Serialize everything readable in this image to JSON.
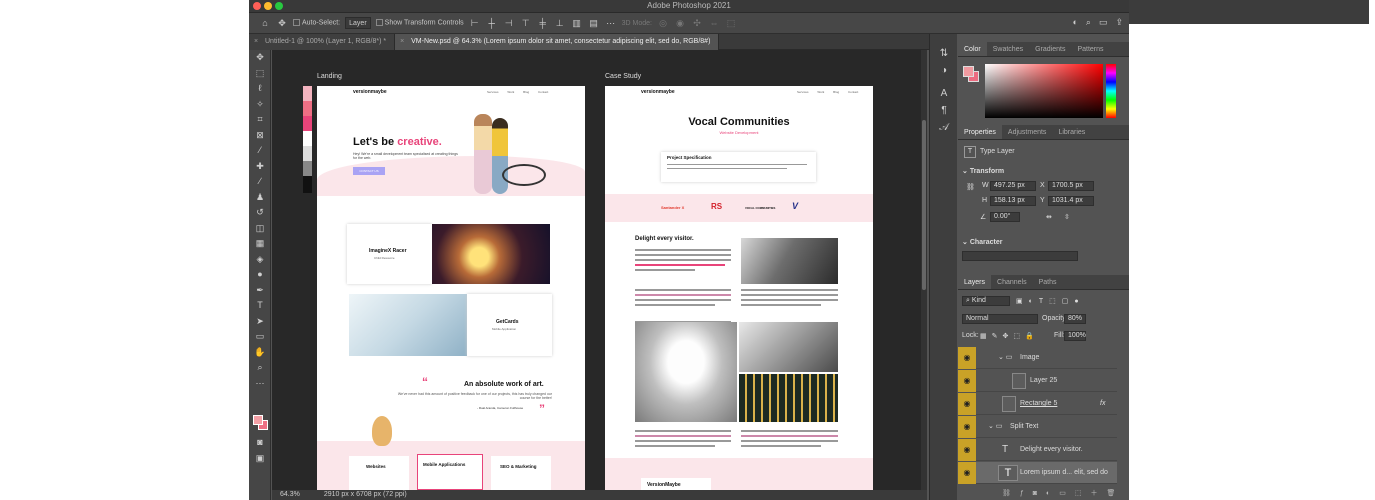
{
  "window": {
    "title": "Adobe Photoshop 2021"
  },
  "options_bar": {
    "auto_select_label": "Auto-Select:",
    "auto_select_value": "Layer",
    "show_transform_label": "Show Transform Controls",
    "mode_3d_label": "3D Mode:"
  },
  "tabs": [
    {
      "label": "Untitled-1 @ 100% (Layer 1, RGB/8*) *"
    },
    {
      "label": "VM-New.psd @ 64.3% (Lorem ipsum dolor sit amet, consectetur adipiscing elit, sed do, RGB/8#)"
    }
  ],
  "canvas": {
    "artboards": [
      {
        "label": "Landing"
      },
      {
        "label": "Case Study"
      }
    ]
  },
  "landing": {
    "logo": "versionmaybe",
    "nav": [
      "Services",
      "Work",
      "Blog",
      "Contact"
    ],
    "hero_title_a": "Let's be ",
    "hero_title_b": "creative.",
    "hero_sub": "Hey! We're a small development team specialised at creating things for the web.",
    "cta": "CONTACT US",
    "card1_title": "ImagineX Racer",
    "card1_sub": "Child Resource",
    "card2_title": "GetCards",
    "card2_sub": "Mobile Application",
    "quote_title": "An absolute work of art.",
    "quote_body": "We've never had this amount of positive feedback for one of our projects, this has truly changed our course for the better!",
    "quote_author": "- Rual Aranda, Cameron Fullhouse",
    "services": [
      "Websites",
      "Mobile Applications",
      "SEO & Marketing"
    ]
  },
  "case_study": {
    "logo": "versionmaybe",
    "title": "Vocal Communities",
    "subtitle": "Website Development",
    "spec_title": "Project Specification",
    "brands": [
      "Santander X",
      "RS",
      "VOCAL COMMUNITIES",
      "V"
    ],
    "section_title": "Delight every visitor.",
    "footer_logo": "VersionMaybe"
  },
  "status": {
    "zoom": "64.3%",
    "doc_size": "2910 px x 6708 px (72 ppi)"
  },
  "color_panel": {
    "tabs": [
      "Color",
      "Swatches",
      "Gradients",
      "Patterns"
    ]
  },
  "properties": {
    "tabs": [
      "Properties",
      "Adjustments",
      "Libraries"
    ],
    "type_label": "Type Layer",
    "transform_label": "Transform",
    "w": "497.25 px",
    "x": "1700.5 px",
    "h": "158.13 px",
    "y": "1031.4 px",
    "angle": "0.00°",
    "character_label": "Character"
  },
  "layers": {
    "tabs": [
      "Layers",
      "Channels",
      "Paths"
    ],
    "filter": "Kind",
    "blend": "Normal",
    "opacity_label": "Opacity:",
    "opacity": "80%",
    "lock_label": "Lock:",
    "fill_label": "Fill:",
    "fill": "100%",
    "items": [
      {
        "name": "Image",
        "kind": "folder"
      },
      {
        "name": "Layer 25",
        "kind": "pixel"
      },
      {
        "name": "Rectangle 5",
        "kind": "shape"
      },
      {
        "name": "Split Text",
        "kind": "folder"
      },
      {
        "name": "Delight every visitor.",
        "kind": "text"
      },
      {
        "name": "Lorem ipsum d... elit, sed do",
        "kind": "text"
      }
    ],
    "fx_label": "fx"
  },
  "colors": {
    "accent_pink": "#e8447a",
    "eye_yellow": "#c9a227",
    "panel_bg": "#535353"
  }
}
